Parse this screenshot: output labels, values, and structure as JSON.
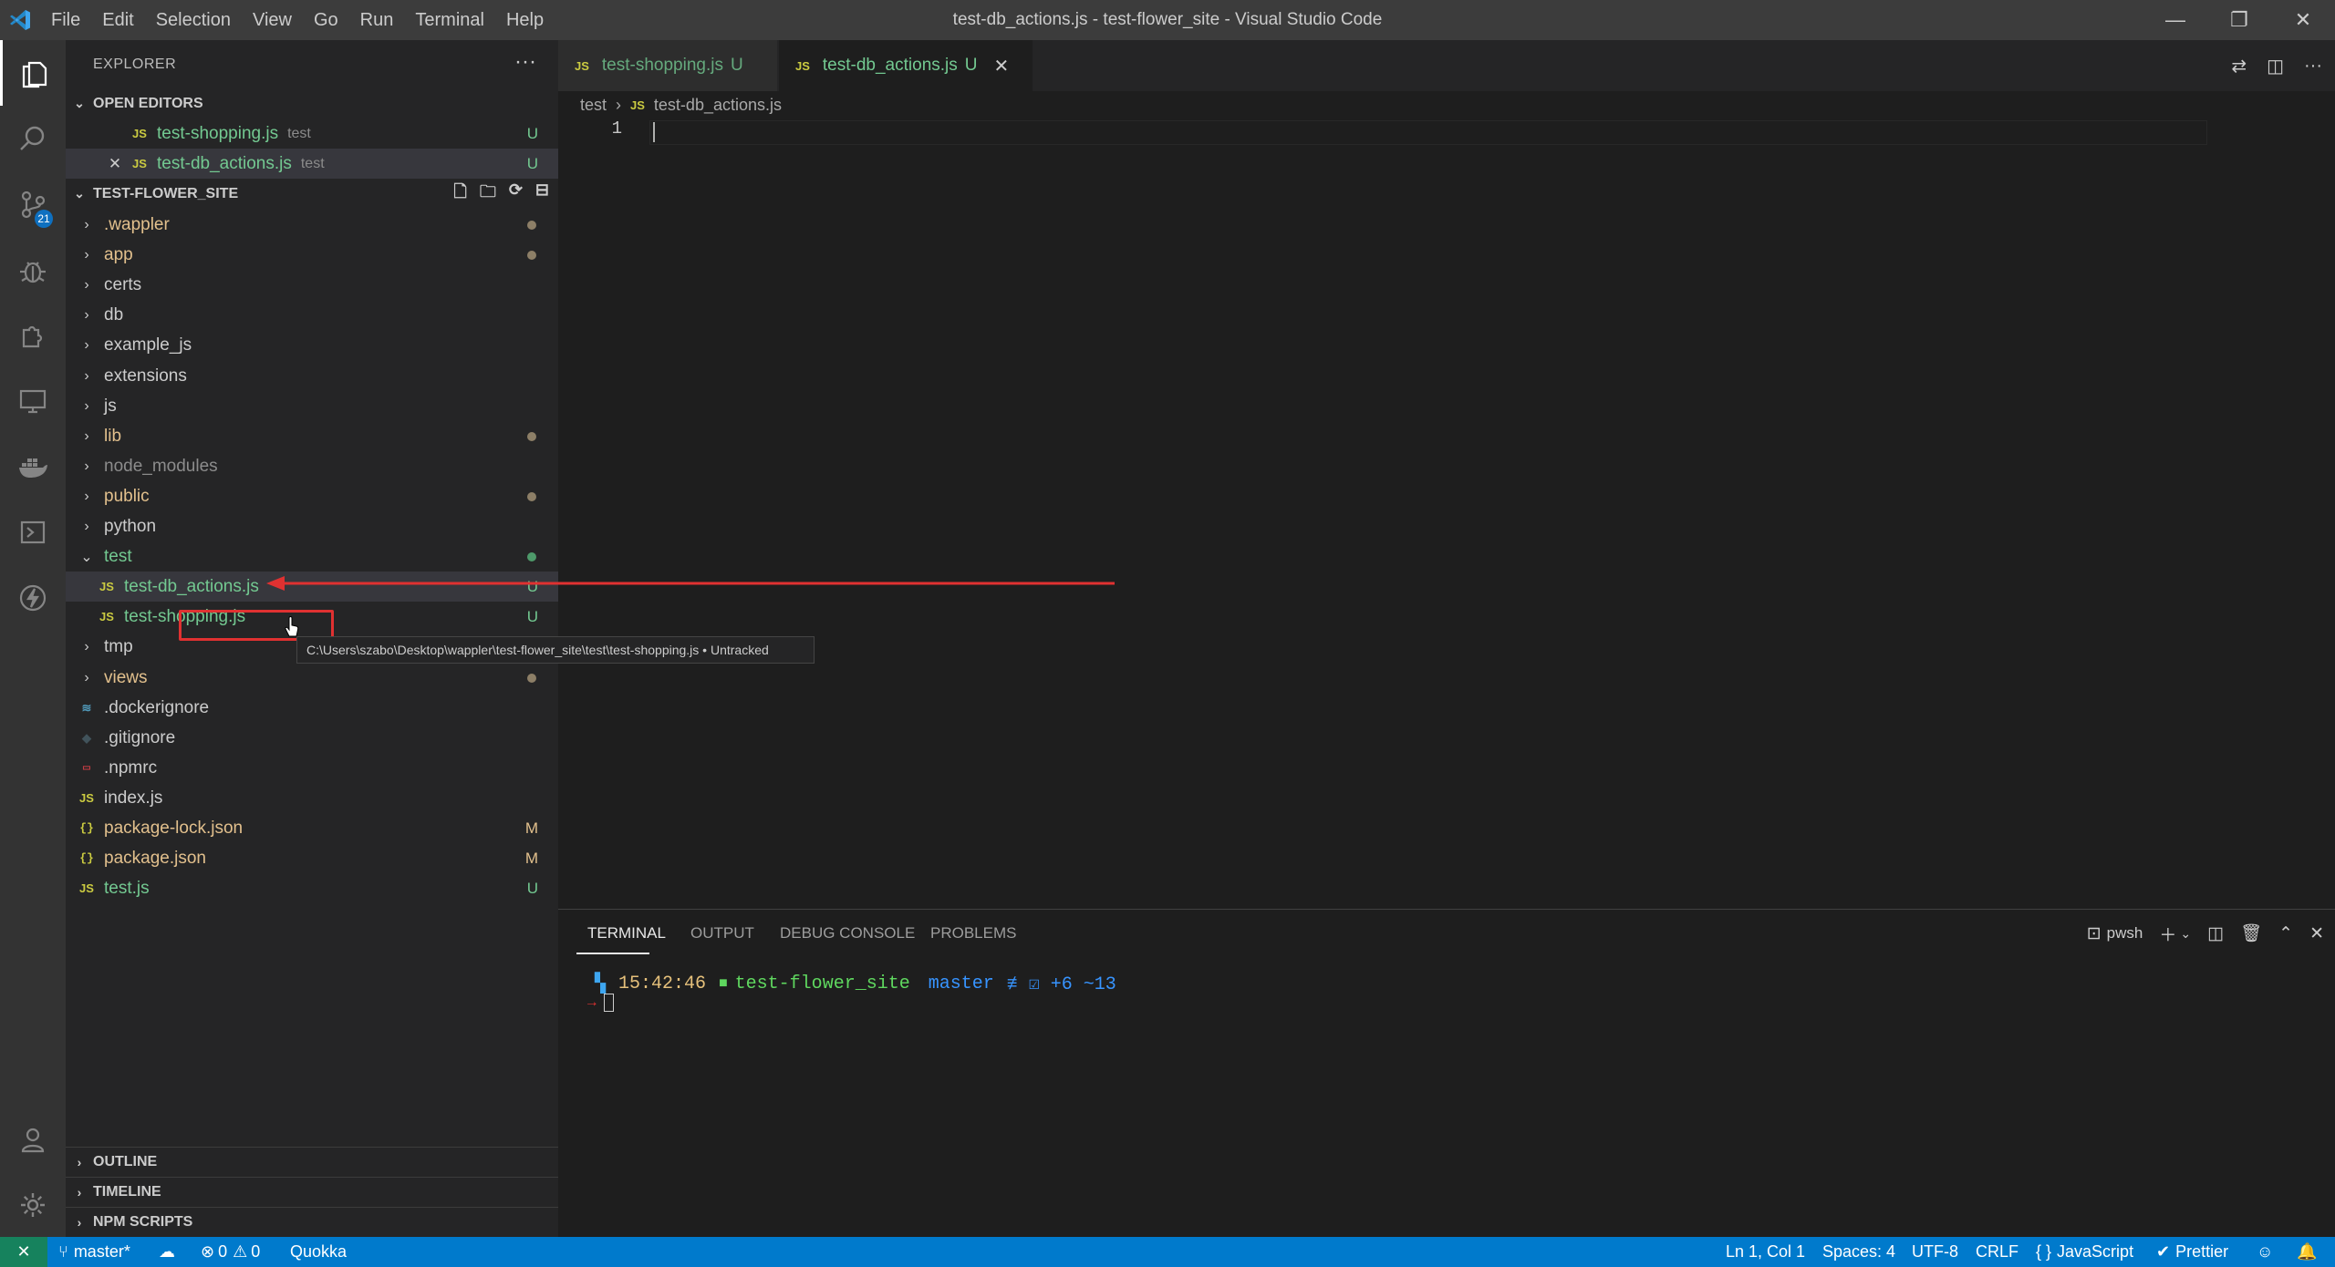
{
  "window": {
    "title": "test-db_actions.js - test-flower_site - Visual Studio Code",
    "menu": [
      "File",
      "Edit",
      "Selection",
      "View",
      "Go",
      "Run",
      "Terminal",
      "Help"
    ],
    "controls": {
      "minimize": "—",
      "restore": "❐",
      "close": "✕"
    }
  },
  "activity": {
    "scm_badge": "21"
  },
  "explorer": {
    "title": "EXPLORER",
    "more": "···",
    "open_editors": {
      "header": "OPEN EDITORS",
      "items": [
        {
          "icon": "JS",
          "name": "test-shopping.js",
          "desc": "test",
          "status": "U"
        },
        {
          "icon": "JS",
          "close": "✕",
          "name": "test-db_actions.js",
          "desc": "test",
          "status": "U"
        }
      ]
    },
    "project": {
      "header": "TEST-FLOWER_SITE",
      "items": [
        {
          "name": ".wappler",
          "kind": "folder",
          "color": "yellow",
          "dot": "#8d7f67"
        },
        {
          "name": "app",
          "kind": "folder",
          "color": "yellow",
          "dot": "#8d7f67"
        },
        {
          "name": "certs",
          "kind": "folder",
          "color": "white"
        },
        {
          "name": "db",
          "kind": "folder",
          "color": "white"
        },
        {
          "name": "example_js",
          "kind": "folder",
          "color": "white"
        },
        {
          "name": "extensions",
          "kind": "folder",
          "color": "white"
        },
        {
          "name": "js",
          "kind": "folder",
          "color": "white"
        },
        {
          "name": "lib",
          "kind": "folder",
          "color": "yellow",
          "dot": "#8d7f67"
        },
        {
          "name": "node_modules",
          "kind": "folder",
          "color": "gray"
        },
        {
          "name": "public",
          "kind": "folder",
          "color": "yellow",
          "dot": "#8d7f67"
        },
        {
          "name": "python",
          "kind": "folder",
          "color": "white"
        },
        {
          "name": "test",
          "kind": "folder-open",
          "color": "green",
          "dot": "#4e9a6a"
        },
        {
          "name": "test-db_actions.js",
          "kind": "js",
          "color": "green",
          "status": "U",
          "selected": true
        },
        {
          "name": "test-shopping.js",
          "kind": "js",
          "color": "green",
          "status": "U"
        },
        {
          "name": "tmp",
          "kind": "folder",
          "color": "white"
        },
        {
          "name": "views",
          "kind": "folder",
          "color": "yellow",
          "dot": "#8d7f67"
        },
        {
          "name": ".dockerignore",
          "kind": "docker",
          "color": "white"
        },
        {
          "name": ".gitignore",
          "kind": "git",
          "color": "white"
        },
        {
          "name": ".npmrc",
          "kind": "npm",
          "color": "white"
        },
        {
          "name": "index.js",
          "kind": "js",
          "color": "white"
        },
        {
          "name": "package-lock.json",
          "kind": "json",
          "color": "yellow",
          "status": "M"
        },
        {
          "name": "package.json",
          "kind": "json",
          "color": "yellow",
          "status": "M"
        },
        {
          "name": "test.js",
          "kind": "js",
          "color": "green",
          "status": "U"
        }
      ]
    },
    "bottom_sections": [
      "OUTLINE",
      "TIMELINE",
      "NPM SCRIPTS"
    ]
  },
  "tooltip": "C:\\Users\\szabo\\Desktop\\wappler\\test-flower_site\\test\\test-shopping.js • Untracked",
  "editor": {
    "tabs": [
      {
        "icon": "JS",
        "name": "test-shopping.js",
        "status": "U"
      },
      {
        "icon": "JS",
        "name": "test-db_actions.js",
        "status": "U",
        "close": "✕"
      }
    ],
    "breadcrumb": {
      "folder": "test",
      "icon": "JS",
      "file": "test-db_actions.js"
    },
    "line_number": "1"
  },
  "panel": {
    "tabs": [
      "TERMINAL",
      "OUTPUT",
      "DEBUG CONSOLE",
      "PROBLEMS"
    ],
    "shell": "pwsh",
    "prompt": {
      "time": "15:42:46",
      "dir": "test-flower_site",
      "branch": "master",
      "branch_status": "≢ ☑ +6 ~13",
      "arrow": "→"
    }
  },
  "statusbar": {
    "remote": "✕",
    "branch": "master*",
    "errors": "0",
    "warnings": "0",
    "quokka": "Quokka",
    "position": "Ln 1, Col 1",
    "spaces": "Spaces: 4",
    "encoding": "UTF-8",
    "eol": "CRLF",
    "language": "JavaScript",
    "prettier": "Prettier"
  },
  "colors": {
    "accent": "#007acc",
    "untracked": "#73c991",
    "modified": "#e2c08d",
    "annotation": "#e03131"
  }
}
